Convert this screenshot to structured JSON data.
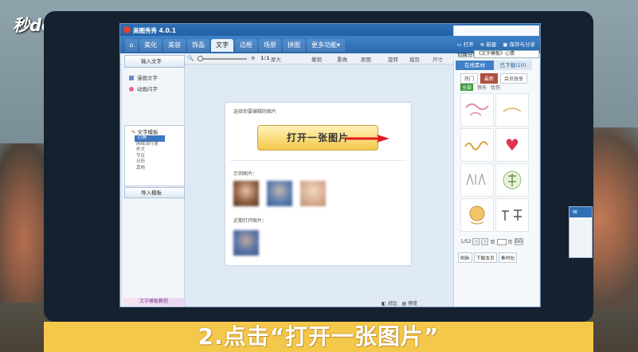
{
  "watermark": {
    "text": "秒dong视频"
  },
  "app": {
    "title": "美图秀秀 4.0.1",
    "title_right": [
      "登录",
      "?",
      "⊡",
      "—",
      "☐",
      "✕"
    ],
    "tabs": [
      {
        "label": "⌂"
      },
      {
        "label": "美化"
      },
      {
        "label": "美容"
      },
      {
        "label": "饰品"
      },
      {
        "label": "文字"
      },
      {
        "label": "边框"
      },
      {
        "label": "场景"
      },
      {
        "label": "拼图"
      },
      {
        "label": "更多功能▾"
      }
    ],
    "nav_right": {
      "open": "打开",
      "new": "新建",
      "save": "保存与分享"
    },
    "toolbar": {
      "zoom_icon": "🔍",
      "ratio": "1:1",
      "original": "原大",
      "undo": "撤销",
      "redo": "重做",
      "reset": "原图",
      "rotate": "旋转",
      "crop": "裁剪",
      "size": "尺寸"
    }
  },
  "left_panel": {
    "input_text": "输入文字",
    "rich_text": "漫画文字",
    "animated_text": "动画闪字",
    "template": "文字模板",
    "template_items": [
      "心情",
      "网络流行语",
      "外文",
      "节日",
      "日历",
      "其他"
    ],
    "import_template": "导入模板",
    "bottom_link": "文字模板教程"
  },
  "canvas": {
    "select_hint": "选择你要编辑的图片",
    "open_button": "打开一张图片",
    "sample_label": "示例图片：",
    "recent_label": "近期打开图片："
  },
  "right_panel": {
    "category_label": "切换分类",
    "category_select": "《文字模板》心情",
    "tabs": [
      "在线素材",
      "已下载(10)"
    ],
    "sub_tabs": [
      "热门",
      "最新",
      "会员独享"
    ],
    "filter_tabs": [
      "全部",
      "快乐",
      "忧伤"
    ],
    "pager": {
      "page": "1/52",
      "to": "到",
      "unit": "页",
      "go": "GO"
    },
    "buttons": [
      "刷新",
      "下载本页",
      "素材包"
    ]
  },
  "bottom_status": {
    "contrast": "对比",
    "preview": "预览"
  },
  "caption": {
    "text": "2.点击“打开一张图片”"
  }
}
